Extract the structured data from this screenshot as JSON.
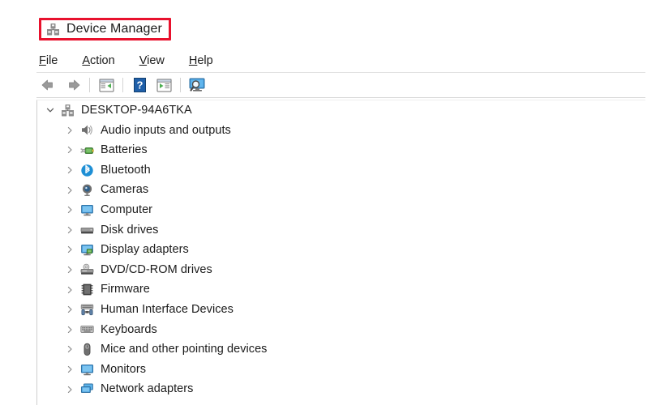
{
  "window": {
    "title": "Device Manager",
    "title_icon": "device-manager-icon",
    "highlight_color": "#e8112d",
    "highlighted": true
  },
  "menubar": {
    "items": [
      {
        "label": "File",
        "accel": "F",
        "name": "menu-file"
      },
      {
        "label": "Action",
        "accel": "A",
        "name": "menu-action"
      },
      {
        "label": "View",
        "accel": "V",
        "name": "menu-view"
      },
      {
        "label": "Help",
        "accel": "H",
        "name": "menu-help"
      }
    ]
  },
  "toolbar": {
    "buttons": [
      {
        "icon": "back-arrow-icon",
        "tooltip": "Back"
      },
      {
        "icon": "forward-arrow-icon",
        "tooltip": "Forward"
      },
      {
        "icon": "show-hide-console-tree-icon",
        "tooltip": "Show/Hide Console Tree"
      },
      {
        "icon": "help-icon",
        "tooltip": "Help"
      },
      {
        "icon": "properties-icon",
        "tooltip": "Properties"
      },
      {
        "icon": "scan-hardware-changes-icon",
        "tooltip": "Scan for hardware changes"
      }
    ]
  },
  "tree": {
    "root": {
      "label": "DESKTOP-94A6TKA",
      "icon": "computer-root-icon",
      "expanded": true,
      "chevron": "chevron-down-icon"
    },
    "items": [
      {
        "label": "Audio inputs and outputs",
        "icon": "speaker-icon",
        "chevron": "chevron-right-icon"
      },
      {
        "label": "Batteries",
        "icon": "battery-icon",
        "chevron": "chevron-right-icon"
      },
      {
        "label": "Bluetooth",
        "icon": "bluetooth-icon",
        "chevron": "chevron-right-icon"
      },
      {
        "label": "Cameras",
        "icon": "camera-icon",
        "chevron": "chevron-right-icon"
      },
      {
        "label": "Computer",
        "icon": "computer-icon",
        "chevron": "chevron-right-icon"
      },
      {
        "label": "Disk drives",
        "icon": "disk-drive-icon",
        "chevron": "chevron-right-icon"
      },
      {
        "label": "Display adapters",
        "icon": "display-adapter-icon",
        "chevron": "chevron-right-icon"
      },
      {
        "label": "DVD/CD-ROM drives",
        "icon": "dvd-drive-icon",
        "chevron": "chevron-right-icon"
      },
      {
        "label": "Firmware",
        "icon": "firmware-icon",
        "chevron": "chevron-right-icon"
      },
      {
        "label": "Human Interface Devices",
        "icon": "hid-icon",
        "chevron": "chevron-right-icon"
      },
      {
        "label": "Keyboards",
        "icon": "keyboard-icon",
        "chevron": "chevron-right-icon"
      },
      {
        "label": "Mice and other pointing devices",
        "icon": "mouse-icon",
        "chevron": "chevron-right-icon"
      },
      {
        "label": "Monitors",
        "icon": "monitor-icon",
        "chevron": "chevron-right-icon"
      },
      {
        "label": "Network adapters",
        "icon": "network-adapter-icon",
        "chevron": "chevron-right-icon"
      }
    ]
  }
}
